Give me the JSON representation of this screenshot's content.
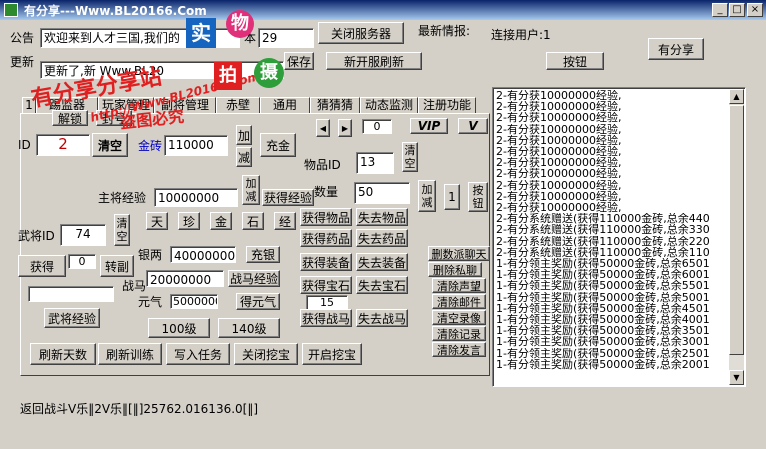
{
  "window": {
    "title": "有分享---Www.BL20166.Com",
    "buttons": {
      "minimize": "_",
      "maximize": "□",
      "close": "×"
    }
  },
  "top": {
    "announce_label": "公告",
    "announce_value": "欢迎来到人才三国,我们的",
    "announce_tail": "本",
    "version_value": "29",
    "close_server": "关闭服务器",
    "latest_info_label": "最新情报:",
    "connected_users": "连接用户:1",
    "share_button": "有分享",
    "update_label": "更新",
    "update_value": "更新了,新",
    "update_url": "Www.BL20",
    "save_button": "保存",
    "new_server_refresh": "新开服刷新",
    "button": "按钮"
  },
  "watermark": {
    "line1": "有分享分享站",
    "line2": "http://Www.BL20166.Com",
    "line3": "盗图必究",
    "stamp1": "实",
    "stamp2": "物",
    "stamp3": "拍",
    "stamp4": "摄"
  },
  "tabs": [
    "1",
    "踢监器",
    "玩家管理",
    "副将管理",
    "赤壁",
    "通用",
    "猜猜猜",
    "动态监测",
    "注册功能"
  ],
  "panel": {
    "unlock_btn": "解锁",
    "ban_btn": "封号",
    "id_label": "ID",
    "id_value": "2",
    "clear_btn": "清空",
    "gold_brick_label": "金砖",
    "gold_brick_value": "110000",
    "add_label": "加",
    "sub_label": "减",
    "charge_btn": "充金",
    "prev_arrow": "◀",
    "next_arrow": "▶",
    "counter_value": "0",
    "vip_btn": "VIP",
    "v_btn": "V",
    "item_id_label": "物品ID",
    "item_id_value": "13",
    "clear_small": "清空",
    "quantity_label": "数量",
    "quantity_value": "50",
    "add_sub_label": "加减",
    "one_value": "1",
    "button_label": "按钮",
    "lord_exp_label": "主将经验",
    "lord_exp_value": "10000000",
    "add_sub_small": "加减",
    "get_exp": "获得经验",
    "get_item": "获得物品",
    "lose_item": "失去物品",
    "get_medicine": "获得药品",
    "lose_medicine": "失去药品",
    "get_equip": "获得装备",
    "lose_equip": "失去装备",
    "get_gem": "获得宝石",
    "lose_gem": "失去宝石",
    "fifteen": "15",
    "get_warhorse": "获得战马",
    "lose_warhorse": "失去战马",
    "sky": "天",
    "treasure": "珍",
    "gold_char": "金",
    "stone": "石",
    "exp_char": "经",
    "general_label": "武将ID",
    "general_value": "74",
    "clear_general": "清空",
    "obtain": "获得",
    "zero_value": "0",
    "convert_deputy": "转副",
    "general_exp_btn": "武将经验",
    "silver_label": "银两",
    "silver_value": "40000000",
    "charge_silver": "充银",
    "warhorse_label": "战马",
    "warhorse_value": "20000000",
    "warhorse_exp": "战马经验",
    "yuanqi_label": "元气",
    "yuanqi_value": "5000000",
    "get_yuanqi": "得元气",
    "btn_100": "100级",
    "btn_140": "140级",
    "refresh_days": "刷新天数",
    "refresh_training": "刷新训练",
    "write_task": "写入任务",
    "close_dig": "关闭挖宝",
    "open_dig": "开启挖宝"
  },
  "right_buttons": [
    "删数派聊天",
    "删除私聊",
    "清除声望",
    "清除邮件",
    "清空录像",
    "清除记录",
    "清除发言"
  ],
  "log": [
    "2-有分获10000000经验,",
    "2-有分获10000000经验,",
    "2-有分获10000000经验,",
    "2-有分获10000000经验,",
    "2-有分获10000000经验,",
    "2-有分获10000000经验,",
    "2-有分获10000000经验,",
    "2-有分获10000000经验,",
    "2-有分获10000000经验,",
    "2-有分获10000000经验,",
    "2-有分获10000000经验,",
    "2-有分系统赠送(获得110000金砖,总余440",
    "2-有分系统赠送(获得110000金砖,总余330",
    "2-有分系统赠送(获得110000金砖,总余220",
    "2-有分系统赠送(获得110000金砖,总余110",
    "1-有分领主奖励(获得50000金砖,总余6501",
    "1-有分领主奖励(获得50000金砖,总余6001",
    "1-有分领主奖励(获得50000金砖,总余5501",
    "1-有分领主奖励(获得50000金砖,总余5001",
    "1-有分领主奖励(获得50000金砖,总余4501",
    "1-有分领主奖励(获得50000金砖,总余4001",
    "1-有分领主奖励(获得50000金砖,总余3501",
    "1-有分领主奖励(获得50000金砖,总余3001",
    "1-有分领主奖励(获得50000金砖,总余2501",
    "1-有分领主奖励(获得50000金砖,总余2001"
  ],
  "status": "返回战斗V乐‖2V乐‖[‖]25762.016136.0[‖]",
  "colors": {
    "face": "#d4d0c8",
    "title_start": "#0a246a",
    "watermark_red": "#e02020",
    "stamp_blue": "#1565c0",
    "stamp_pink": "#e0307a",
    "stamp_green": "#2e9e3a"
  }
}
